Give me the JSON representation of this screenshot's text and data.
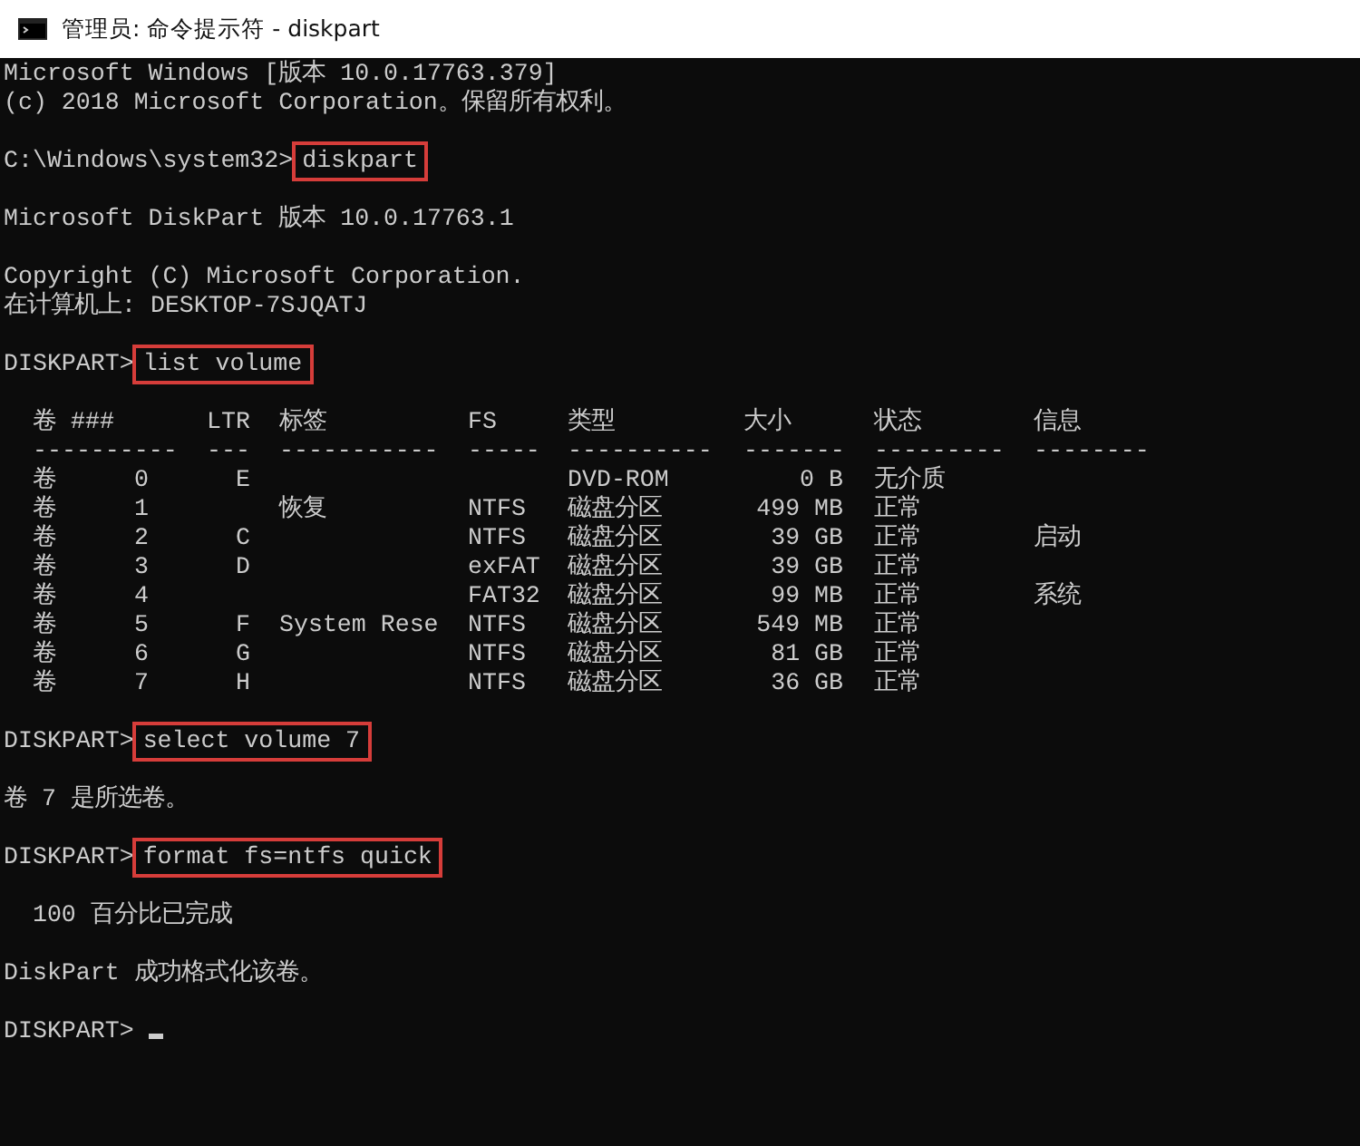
{
  "window": {
    "title": "管理员: 命令提示符 - diskpart"
  },
  "lines": [
    {
      "kind": "text",
      "text": "Microsoft Windows [版本 10.0.17763.379]"
    },
    {
      "kind": "text",
      "text": "(c) 2018 Microsoft Corporation。保留所有权利。"
    },
    {
      "kind": "blank"
    },
    {
      "kind": "command",
      "prompt": "C:\\Windows\\system32>",
      "command": "diskpart",
      "highlighted": true
    },
    {
      "kind": "blank"
    },
    {
      "kind": "text",
      "text": "Microsoft DiskPart 版本 10.0.17763.1"
    },
    {
      "kind": "blank"
    },
    {
      "kind": "text",
      "text": "Copyright (C) Microsoft Corporation."
    },
    {
      "kind": "text",
      "text": "在计算机上: DESKTOP-7SJQATJ"
    },
    {
      "kind": "blank"
    },
    {
      "kind": "command",
      "prompt": "DISKPART>",
      "command": "list volume",
      "highlighted": true
    },
    {
      "kind": "blank"
    },
    {
      "kind": "table",
      "columns": [
        {
          "label": "卷 ###",
          "rule": "----------"
        },
        {
          "label": "LTR",
          "rule": "---"
        },
        {
          "label": "标签",
          "rule": "-----------"
        },
        {
          "label": "FS",
          "rule": "-----"
        },
        {
          "label": "类型",
          "rule": "----------"
        },
        {
          "label": "大小",
          "rule": "-------"
        },
        {
          "label": "状态",
          "rule": "---------"
        },
        {
          "label": "信息",
          "rule": "--------"
        }
      ],
      "rows": [
        {
          "vol": "卷",
          "num": "0",
          "ltr": "E",
          "type": "DVD-ROM",
          "size": "0 B",
          "status": "无介质"
        },
        {
          "vol": "卷",
          "num": "1",
          "label": "恢复",
          "fs": "NTFS",
          "type": "磁盘分区",
          "size": "499 MB",
          "status": "正常"
        },
        {
          "vol": "卷",
          "num": "2",
          "ltr": "C",
          "fs": "NTFS",
          "type": "磁盘分区",
          "size": "39 GB",
          "status": "正常",
          "info": "启动"
        },
        {
          "vol": "卷",
          "num": "3",
          "ltr": "D",
          "fs": "exFAT",
          "type": "磁盘分区",
          "size": "39 GB",
          "status": "正常"
        },
        {
          "vol": "卷",
          "num": "4",
          "fs": "FAT32",
          "type": "磁盘分区",
          "size": "99 MB",
          "status": "正常",
          "info": "系统"
        },
        {
          "vol": "卷",
          "num": "5",
          "ltr": "F",
          "label": "System Rese",
          "fs": "NTFS",
          "type": "磁盘分区",
          "size": "549 MB",
          "status": "正常"
        },
        {
          "vol": "卷",
          "num": "6",
          "ltr": "G",
          "fs": "NTFS",
          "type": "磁盘分区",
          "size": "81 GB",
          "status": "正常"
        },
        {
          "vol": "卷",
          "num": "7",
          "ltr": "H",
          "fs": "NTFS",
          "type": "磁盘分区",
          "size": "36 GB",
          "status": "正常"
        }
      ]
    },
    {
      "kind": "blank"
    },
    {
      "kind": "command",
      "prompt": "DISKPART>",
      "command": "select volume 7",
      "highlighted": true
    },
    {
      "kind": "blank"
    },
    {
      "kind": "text",
      "text": "卷 7 是所选卷。"
    },
    {
      "kind": "blank"
    },
    {
      "kind": "command",
      "prompt": "DISKPART>",
      "command": "format fs=ntfs quick",
      "highlighted": true
    },
    {
      "kind": "blank"
    },
    {
      "kind": "text",
      "text": "  100 百分比已完成"
    },
    {
      "kind": "blank"
    },
    {
      "kind": "text",
      "text": "DiskPart 成功格式化该卷。"
    },
    {
      "kind": "blank"
    },
    {
      "kind": "prompt",
      "prompt": "DISKPART>",
      "cursor": true
    }
  ]
}
